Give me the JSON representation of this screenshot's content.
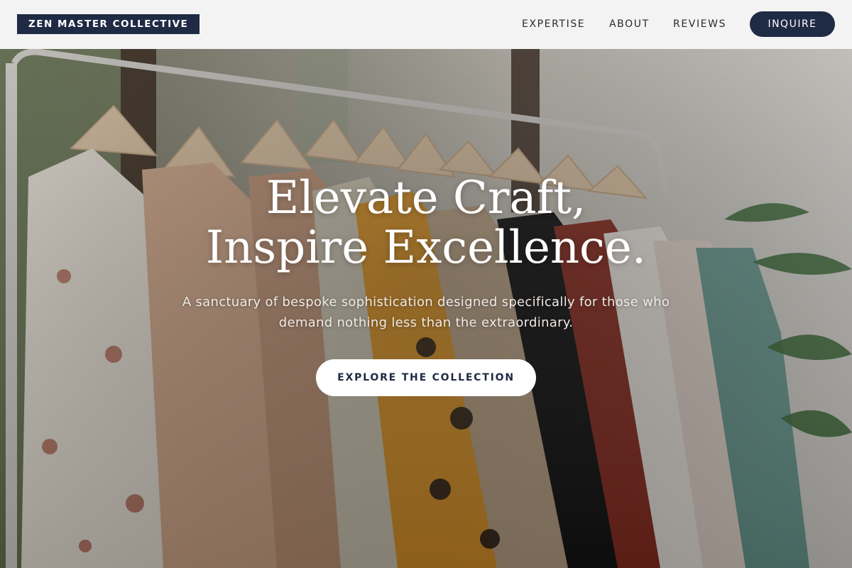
{
  "header": {
    "logo": "ZEN MASTER COLLECTIVE",
    "nav": {
      "expertise": "EXPERTISE",
      "about": "ABOUT",
      "reviews": "REVIEWS"
    },
    "cta_label": "INQUIRE"
  },
  "hero": {
    "title_line1": "Elevate Craft,",
    "title_line2": "Inspire Excellence.",
    "subtitle": "A sanctuary of bespoke sophistication designed specifically for those who demand nothing less than the extraordinary.",
    "cta_label": "EXPLORE THE COLLECTION",
    "image_subject": "clothing-rack-with-garments"
  },
  "colors": {
    "brand_navy": "#1f2a44",
    "header_bg": "#fafafa",
    "cta_bg": "#ffffff"
  }
}
